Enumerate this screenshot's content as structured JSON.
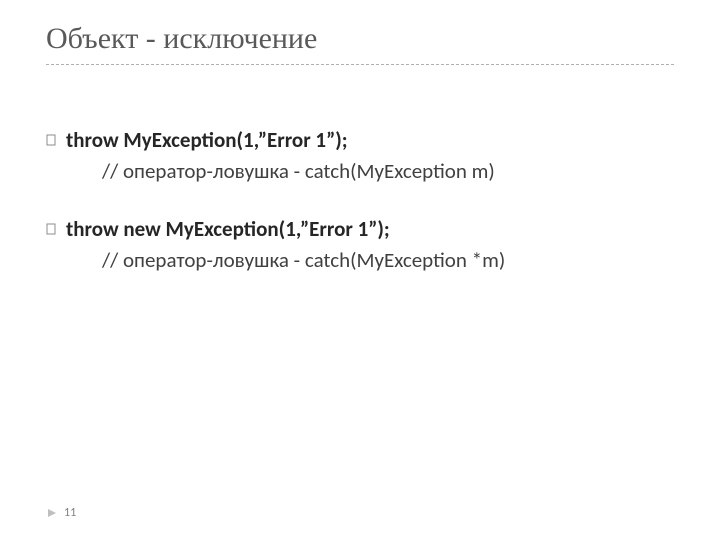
{
  "title": "Объект - исключение",
  "blocks": [
    {
      "main": "throw  MyException(1,”Error 1”);",
      "sub": "// оператор-ловушка  - catch(MyException m)"
    },
    {
      "main": "throw  new MyException(1,”Error 1”);",
      "sub": "// оператор-ловушка - catch(MyException *m)"
    }
  ],
  "page_number": "11"
}
